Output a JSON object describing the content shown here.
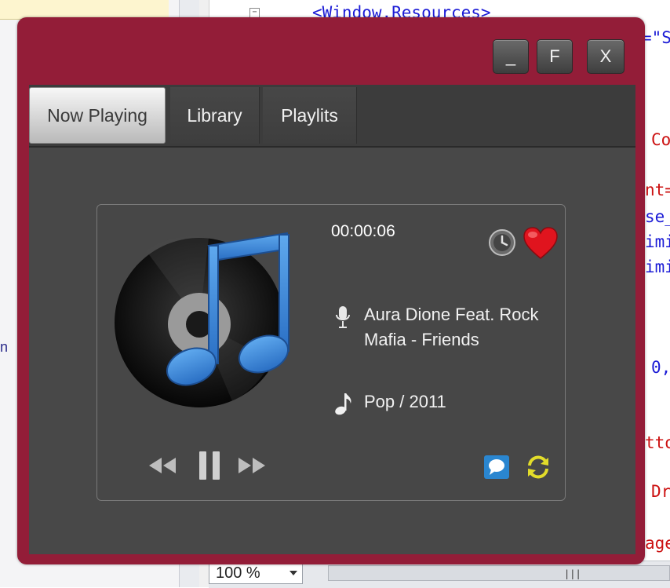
{
  "ide": {
    "code_lines": [
      {
        "text": "<Window.Resources>",
        "color": "blue"
      },
      {
        "text": "=\"S",
        "color": "blue"
      },
      {
        "text": "Co",
        "color": "red"
      },
      {
        "text": "nt=",
        "color": "red"
      },
      {
        "text": "se_",
        "color": "blue"
      },
      {
        "text": "imi",
        "color": "blue"
      },
      {
        "text": "imi",
        "color": "blue"
      },
      {
        "text": "0,",
        "color": "blue"
      },
      {
        "text": "tto",
        "color": "red"
      },
      {
        "text": "Dr",
        "color": "red"
      },
      {
        "text": "age",
        "color": "red"
      }
    ],
    "fold_marker": "−",
    "left_panel_char": "n",
    "zoom_value": "100 %",
    "scroll_glyph": "|||"
  },
  "window": {
    "minimize_label": "_",
    "fullscreen_label": "F",
    "close_label": "X",
    "accent_color": "#931d38"
  },
  "tabs": [
    {
      "label": "Now Playing",
      "active": true
    },
    {
      "label": "Library",
      "active": false
    },
    {
      "label": "Playlits",
      "active": false
    }
  ],
  "player": {
    "elapsed_time": "00:00:06",
    "track_title": "Aura Dione Feat. Rock Mafia - Friends",
    "genre_year": "Pop / 2011",
    "favorite": true,
    "icons": {
      "album": "music-note-album-art",
      "clock": "clock-icon",
      "favorite": "heart-icon",
      "artist": "microphone-icon",
      "genre": "music-note-icon",
      "previous": "rewind-icon",
      "play_state": "pause-icon",
      "next": "fast-forward-icon",
      "lyrics": "chat-bubble-icon",
      "repeat": "repeat-icon"
    },
    "colors": {
      "heart": "#e0141e",
      "note_blue": "#3d8fe0",
      "repeat_yellow": "#e2dc2a",
      "chat_blue": "#2a86d0"
    }
  }
}
